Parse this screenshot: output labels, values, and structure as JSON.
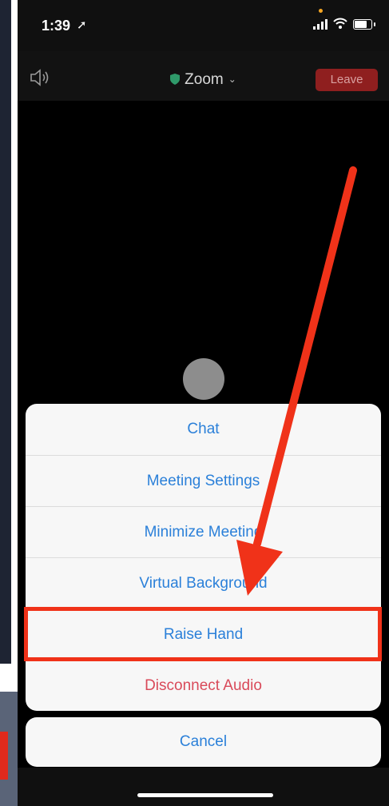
{
  "status_bar": {
    "time": "1:39",
    "location_glyph": "➚"
  },
  "top_bar": {
    "title": "Zoom",
    "title_chevron": "⌄",
    "leave_label": "Leave"
  },
  "action_sheet": {
    "items": [
      {
        "label": "Chat"
      },
      {
        "label": "Meeting Settings"
      },
      {
        "label": "Minimize Meeting"
      },
      {
        "label": "Virtual Background"
      },
      {
        "label": "Raise Hand",
        "highlighted": true
      },
      {
        "label": "Disconnect Audio",
        "destructive": true
      }
    ],
    "cancel_label": "Cancel"
  },
  "colors": {
    "accent": "#2b80d9",
    "destructive": "#d94a5a",
    "annotation": "#f03219",
    "leave_button": "#8f1f1f"
  },
  "icons": [
    "speaker-icon",
    "shield-icon",
    "chevron-down-icon",
    "signal-icon",
    "wifi-icon",
    "battery-icon",
    "location-arrow-icon"
  ]
}
